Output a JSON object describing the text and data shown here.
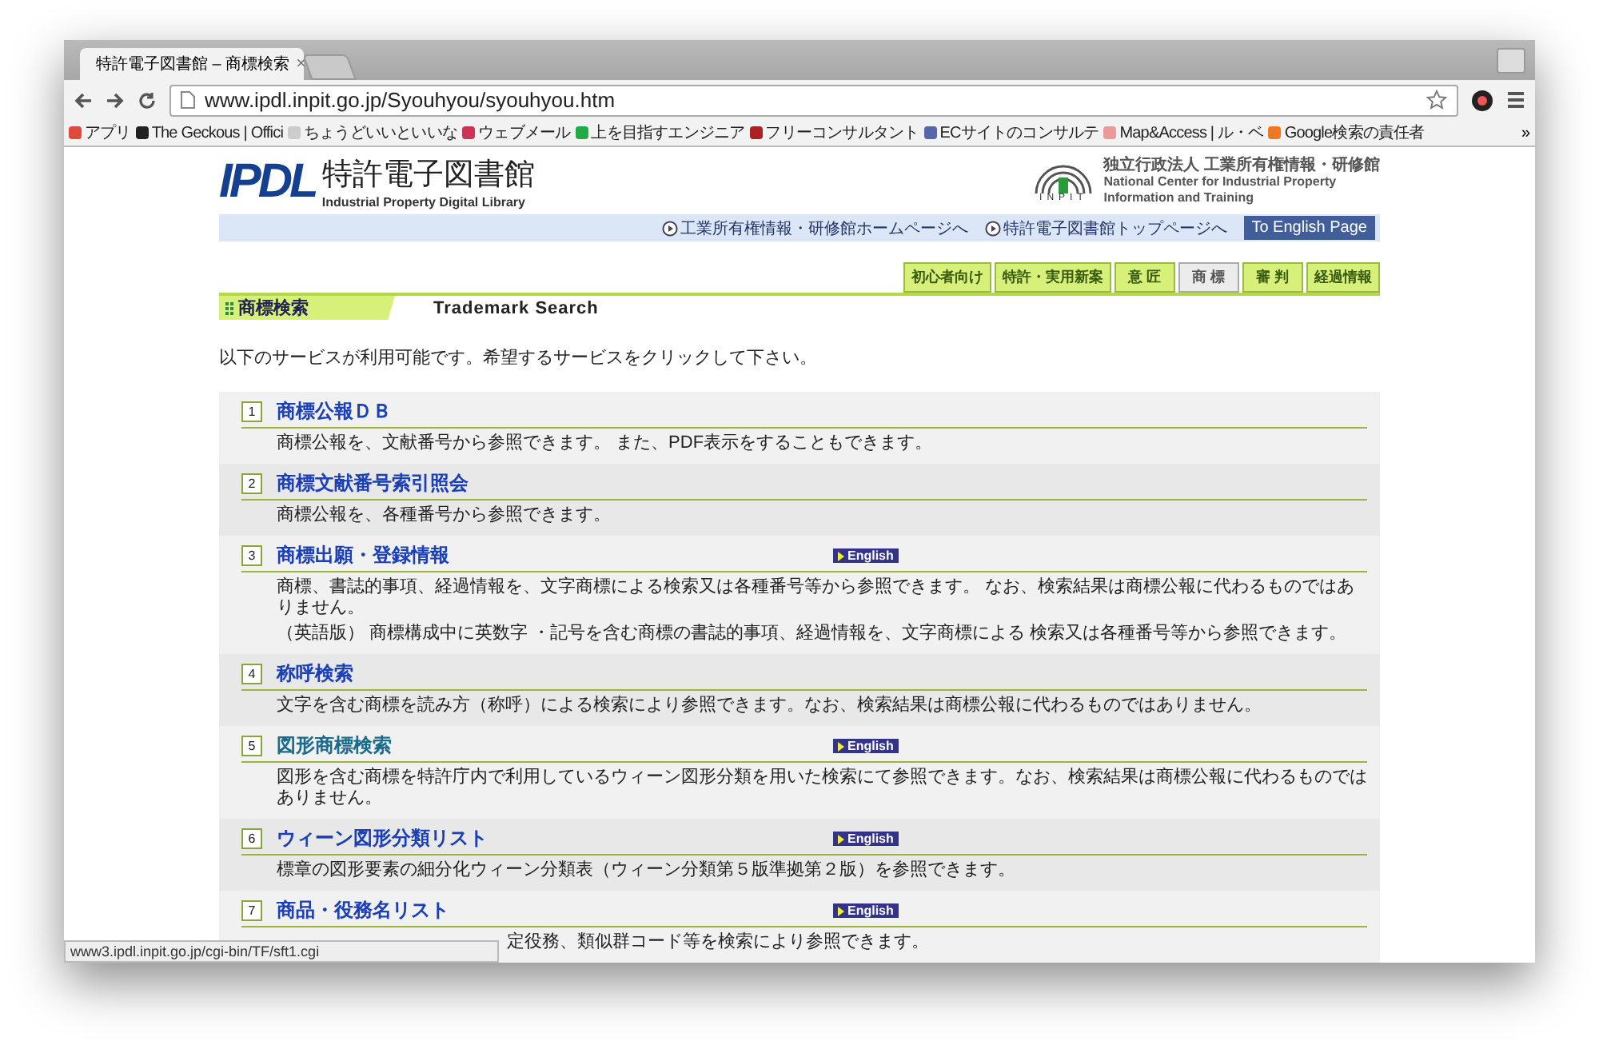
{
  "browser": {
    "tab": {
      "title": "特許電子図書館 – 商標検索",
      "close": "×"
    },
    "url": "www.ipdl.inpit.go.jp/Syouhyou/syouhyou.htm",
    "bookmarks": [
      {
        "label": "アプリ",
        "color": "#e04a3a"
      },
      {
        "label": "The Geckous | Offici",
        "color": "#222222"
      },
      {
        "label": "ちょうどいいといいな",
        "color": "#cccccc"
      },
      {
        "label": "ウェブメール",
        "color": "#cc3355"
      },
      {
        "label": "上を目指すエンジニア",
        "color": "#22aa44"
      },
      {
        "label": "フリーコンサルタント",
        "color": "#aa2222"
      },
      {
        "label": "ECサイトのコンサルテ",
        "color": "#5566aa"
      },
      {
        "label": "Map&Access | ル・ベ",
        "color": "#ee9999"
      },
      {
        "label": "Google検索の責任者",
        "color": "#ee7722"
      }
    ],
    "more": "»",
    "status": "www3.ipdl.inpit.go.jp/cgi-bin/TF/sft1.cgi"
  },
  "header": {
    "logo": "IPDL",
    "name": "特許電子図書館",
    "subtitle": "Industrial Property Digital Library",
    "org_logo": "INPIT",
    "org_lines": [
      "独立行政法人 工業所有権情報・研修館",
      "National Center for Industrial Property",
      "Information and Training"
    ]
  },
  "top_links": [
    "工業所有権情報・研修館ホームページへ",
    "特許電子図書館トップページへ"
  ],
  "english_button": "To English Page",
  "nav_tabs": [
    {
      "label": "初心者向け",
      "selected": false
    },
    {
      "label": "特許・実用新案",
      "selected": false
    },
    {
      "label": "意 匠",
      "selected": false
    },
    {
      "label": "商 標",
      "selected": true
    },
    {
      "label": "審 判",
      "selected": false
    },
    {
      "label": "経過情報",
      "selected": false
    }
  ],
  "section": {
    "label": "商標検索",
    "title": "Trademark Search"
  },
  "intro": "以下のサービスが利用可能です。希望するサービスをクリックして下さい。",
  "services": [
    {
      "number": "1",
      "title": "商標公報ＤＢ",
      "hovered": false,
      "description": [
        "商標公報を、文献番号から参照できます。 また、PDF表示をすることもできます。"
      ]
    },
    {
      "number": "2",
      "title": "商標文献番号索引照会",
      "hovered": false,
      "description": [
        "商標公報を、各種番号から参照できます。"
      ]
    },
    {
      "number": "3",
      "title": "商標出願・登録情報",
      "hovered": false,
      "badge": "English",
      "description": [
        "商標、書誌的事項、経過情報を、文字商標による検索又は各種番号等から参照できます。 なお、検索結果は商標公報に代わるものではありません。",
        "（英語版） 商標構成中に英数字 ・記号を含む商標の書誌的事項、経過情報を、文字商標による 検索又は各種番号等から参照できます。"
      ]
    },
    {
      "number": "4",
      "title": "称呼検索",
      "hovered": false,
      "description": [
        "文字を含む商標を読み方（称呼）による検索により参照できます。なお、検索結果は商標公報に代わるものではありません。"
      ]
    },
    {
      "number": "5",
      "title": "図形商標検索",
      "hovered": true,
      "badge": "English",
      "description": [
        "図形を含む商標を特許庁内で利用しているウィーン図形分類を用いた検索にて参照できます。なお、検索結果は商標公報に代わるものではありません。"
      ]
    },
    {
      "number": "6",
      "title": "ウィーン図形分類リスト",
      "hovered": false,
      "badge": "English",
      "description": [
        "標章の図形要素の細分化ウィーン分類表（ウィーン分類第５版準拠第２版）を参照できます。"
      ]
    },
    {
      "number": "7",
      "title": "商品・役務名リスト",
      "hovered": false,
      "badge": "English",
      "covered": true,
      "description": [
        "定役務、類似群コード等を検索により参照できます。"
      ]
    }
  ]
}
